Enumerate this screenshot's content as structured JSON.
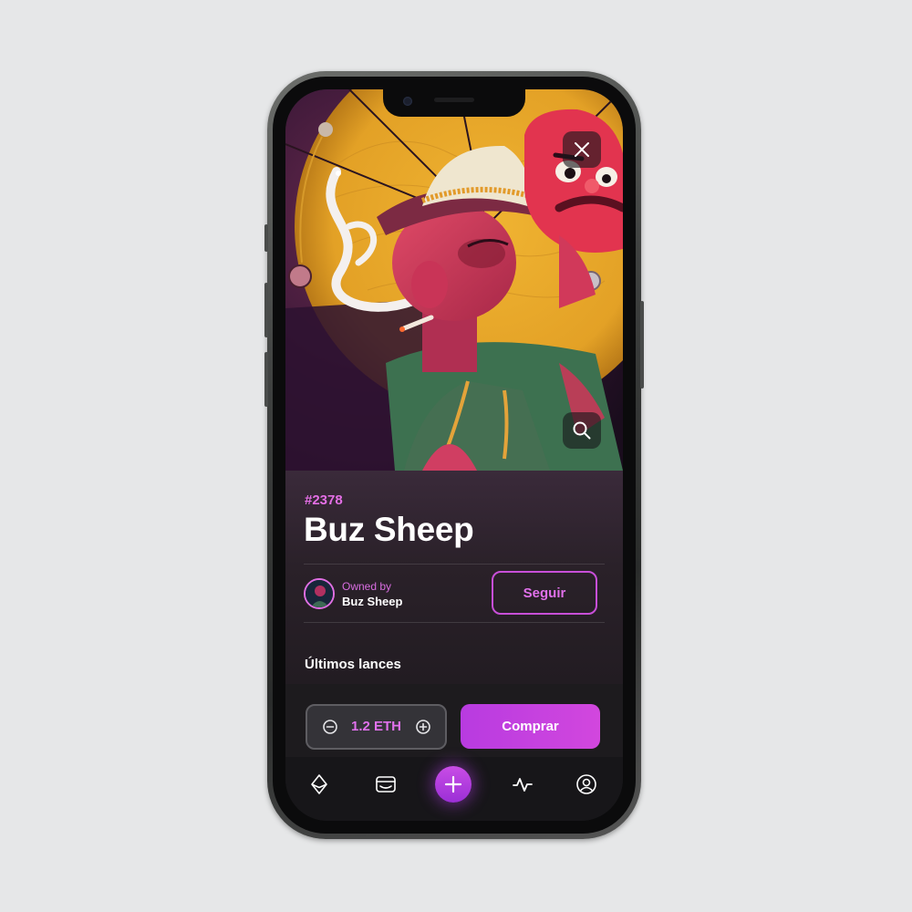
{
  "nft": {
    "token_id": "#2378",
    "title": "Buz Sheep",
    "owned_by_label": "Owned by",
    "owner_name": "Buz Sheep",
    "follow_label": "Seguir",
    "bids_label": "Últimos lances"
  },
  "purchase": {
    "price": "1.2 ETH",
    "buy_label": "Comprar"
  },
  "icons": {
    "close": "close-icon",
    "zoom": "search-icon",
    "decrement": "minus-circle-icon",
    "increment": "plus-circle-icon",
    "explore": "ethereum-icon",
    "wallet": "wallet-icon",
    "add": "plus-icon",
    "activity": "activity-icon",
    "profile": "user-circle-icon"
  },
  "colors": {
    "accent": "#d247de",
    "accent_text": "#e46fe6",
    "panel_bg": "#2a2129",
    "tabbar_bg": "#171619"
  }
}
